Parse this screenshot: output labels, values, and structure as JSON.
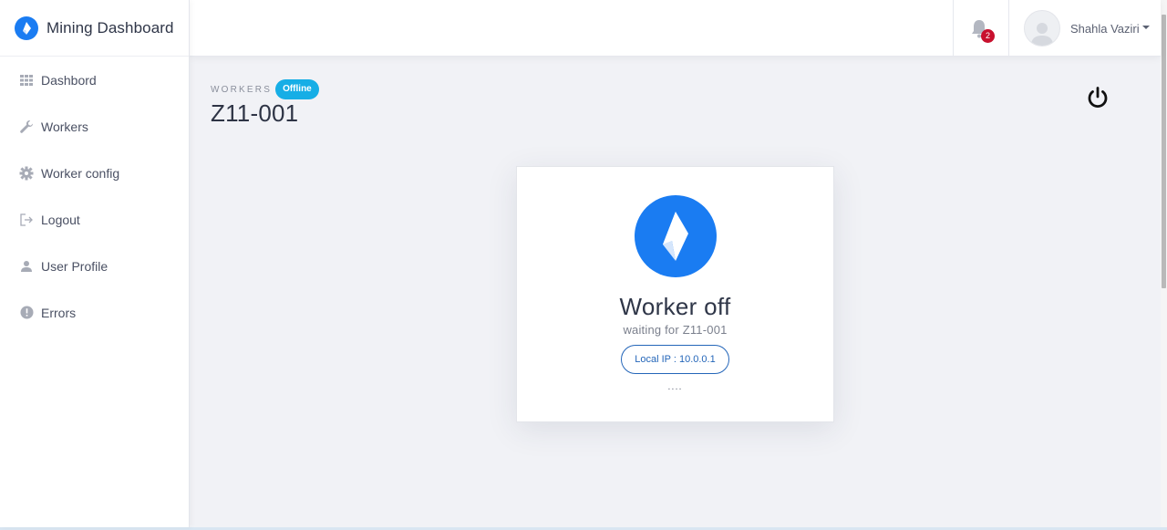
{
  "app": {
    "brand_title": "Mining Dashboard"
  },
  "sidebar": {
    "items": [
      {
        "label": "Dashbord",
        "icon": "grid-icon"
      },
      {
        "label": "Workers",
        "icon": "wrench-icon"
      },
      {
        "label": "Worker config",
        "icon": "gear-icon"
      },
      {
        "label": "Logout",
        "icon": "logout-icon"
      },
      {
        "label": "User Profile",
        "icon": "user-icon"
      },
      {
        "label": "Errors",
        "icon": "alert-circle-icon"
      }
    ]
  },
  "topbar": {
    "notifications_count": "2",
    "user_name": "Shahla Vaziri"
  },
  "header": {
    "section_label": "WORKERS",
    "status": "Offline",
    "title": "Z11-001"
  },
  "card": {
    "title": "Worker off",
    "subtitle": "waiting for Z11-001",
    "ip_label": "Local IP : 10.0.0.1",
    "dots": "...."
  },
  "colors": {
    "brand_blue": "#1a7cf2",
    "status_badge": "#16aee6",
    "notification_badge": "#c8102e",
    "ip_pill_border": "#2466b9"
  }
}
